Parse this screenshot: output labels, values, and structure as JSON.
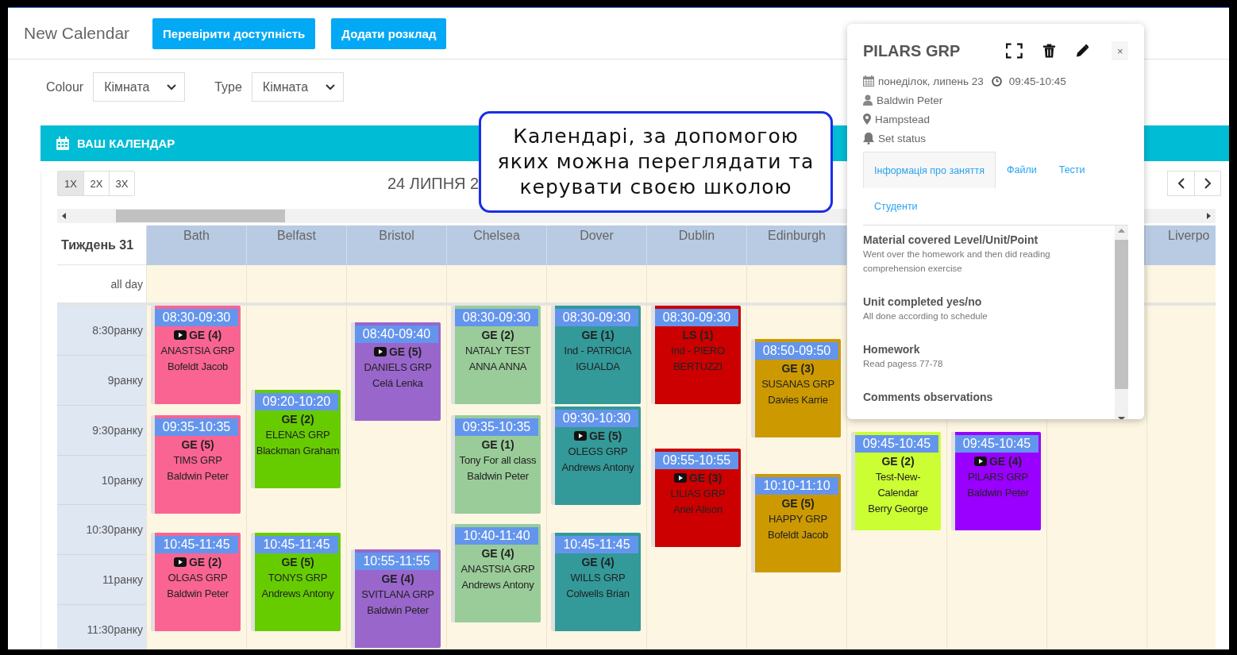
{
  "header": {
    "title": "New Calendar",
    "buttons": [
      "Перевірити доступність",
      "Додати розклад"
    ]
  },
  "filters": [
    {
      "label": "Colour",
      "value": "Кімната"
    },
    {
      "label": "Type",
      "value": "Кімната"
    }
  ],
  "calendar": {
    "title": "ВАШ КАЛЕНДАР",
    "zoom": [
      {
        "label": "1X",
        "selected": true
      },
      {
        "label": "2X",
        "selected": false
      },
      {
        "label": "3X",
        "selected": false
      }
    ],
    "date": "24 ЛИПНЯ 2",
    "week": "Тиждень 31",
    "all_day": "all day",
    "times": [
      "8:30ранку",
      "9ранку",
      "9:30ранку",
      "10ранку",
      "10:30ранку",
      "11ранку",
      "11:30ранку"
    ],
    "columns": [
      {
        "name": "Bath",
        "events": [
          {
            "time": "08:30-09:30",
            "subject": "GE (4)",
            "video": true,
            "group": "ANASTSIA GRP",
            "teacher": "Bofeldt Jacob",
            "color": "#fa6493"
          },
          {
            "time": "09:35-10:35",
            "subject": "GE (5)",
            "video": false,
            "group": "TIMS GRP",
            "teacher": "Baldwin Peter",
            "color": "#fa6493"
          },
          {
            "time": "10:45-11:45",
            "subject": "GE (2)",
            "video": true,
            "group": "OLGAS GRP",
            "teacher": "Baldwin Peter",
            "color": "#fa6493"
          }
        ]
      },
      {
        "name": "Belfast",
        "events": [
          {
            "time": "09:20-10:20",
            "subject": "GE (2)",
            "video": false,
            "group": "ELENAS GRP",
            "teacher": "Blackman Graham",
            "color": "#66cc00"
          },
          {
            "time": "10:45-11:45",
            "subject": "GE (5)",
            "video": false,
            "group": "TONYS GRP",
            "teacher": "Andrews Antony",
            "color": "#66cc00"
          }
        ]
      },
      {
        "name": "Bristol",
        "events": [
          {
            "time": "08:40-09:40",
            "subject": "GE (5)",
            "video": true,
            "group": "DANIELS GRP",
            "teacher": "Celá Lenka",
            "color": "#9966cc"
          },
          {
            "time": "10:55-11:55",
            "subject": "GE (4)",
            "video": false,
            "group": "SVITLANA GRP",
            "teacher": "Baldwin Peter",
            "color": "#9966cc"
          }
        ]
      },
      {
        "name": "Chelsea",
        "events": [
          {
            "time": "08:30-09:30",
            "subject": "GE (2)",
            "video": false,
            "group": "NATALY TEST",
            "teacher": "ANNA ANNA",
            "color": "#99cc99"
          },
          {
            "time": "09:35-10:35",
            "subject": "GE (1)",
            "video": false,
            "group": "Tony For all class",
            "teacher": "Baldwin Peter",
            "color": "#99cc99"
          },
          {
            "time": "10:40-11:40",
            "subject": "GE (4)",
            "video": false,
            "group": "ANASTSIA GRP",
            "teacher": "Andrews Antony",
            "color": "#99cc99"
          }
        ]
      },
      {
        "name": "Dover",
        "events": [
          {
            "time": "08:30-09:30",
            "subject": "GE (1)",
            "video": false,
            "group": "Ind - PATRICIA IGUALDA",
            "color": "#339999"
          },
          {
            "time": "09:30-10:30",
            "subject": "GE (5)",
            "video": true,
            "group": "OLEGS GRP",
            "teacher": "Andrews Antony",
            "color": "#339999"
          },
          {
            "time": "10:45-11:45",
            "subject": "GE (4)",
            "video": false,
            "group": "WILLS GRP",
            "teacher": "Colwells Brian",
            "color": "#339999"
          }
        ]
      },
      {
        "name": "Dublin",
        "events": [
          {
            "time": "08:30-09:30",
            "subject": "LS (1)",
            "video": false,
            "group": "Ind - PIERO BERTUZZI",
            "color": "#cc0000"
          },
          {
            "time": "09:55-10:55",
            "subject": "GE (3)",
            "video": true,
            "group": "LILIAS GRP",
            "teacher": "Ariel Alison",
            "color": "#cc0000"
          }
        ]
      },
      {
        "name": "Edinburgh",
        "events": [
          {
            "time": "08:50-09:50",
            "subject": "GE (3)",
            "video": false,
            "group": "SUSANAS GRP",
            "teacher": "Davies Karrie",
            "color": "#cc9900"
          },
          {
            "time": "10:10-11:10",
            "subject": "GE (5)",
            "video": false,
            "group": "HAPPY GRP",
            "teacher": "Bofeldt Jacob",
            "color": "#cc9900"
          }
        ]
      },
      {
        "events": [
          {
            "time": "09:45-10:45",
            "subject": "GE (2)",
            "video": false,
            "group": "Test-New-Calendar",
            "teacher": "Berry George",
            "color": "#ccff33"
          }
        ]
      },
      {
        "events": [
          {
            "time": "09:45-10:45",
            "subject": "GE (4)",
            "video": true,
            "group": "PILARS GRP",
            "teacher": "Baldwin Peter",
            "color": "#9900ff"
          }
        ]
      },
      {},
      {
        "name": "Liverpo"
      }
    ]
  },
  "popup": {
    "title": "PILARS GRP",
    "close": "×",
    "date": "понеділок, липень 23",
    "time": "09:45-10:45",
    "teacher": "Baldwin Peter",
    "location": "Hampstead",
    "status": "Set status",
    "tabs": [
      {
        "label": "Інформація про заняття",
        "selected": true
      },
      {
        "label": "Файли",
        "selected": false
      },
      {
        "label": "Тести",
        "selected": false
      },
      {
        "label": "Студенти",
        "selected": false
      }
    ],
    "fields": [
      {
        "label": "Material covered Level/Unit/Point",
        "value": "Went over the homework and then did reading comprehension exercise"
      },
      {
        "label": "Unit completed yes/no",
        "value": "All done according to schedule"
      },
      {
        "label": "Homework",
        "value": "Read pagess 77-78"
      },
      {
        "label": "Comments observations"
      }
    ]
  },
  "callout": "Календарі, за допомогою яких можна переглядати та керувати своєю школою"
}
